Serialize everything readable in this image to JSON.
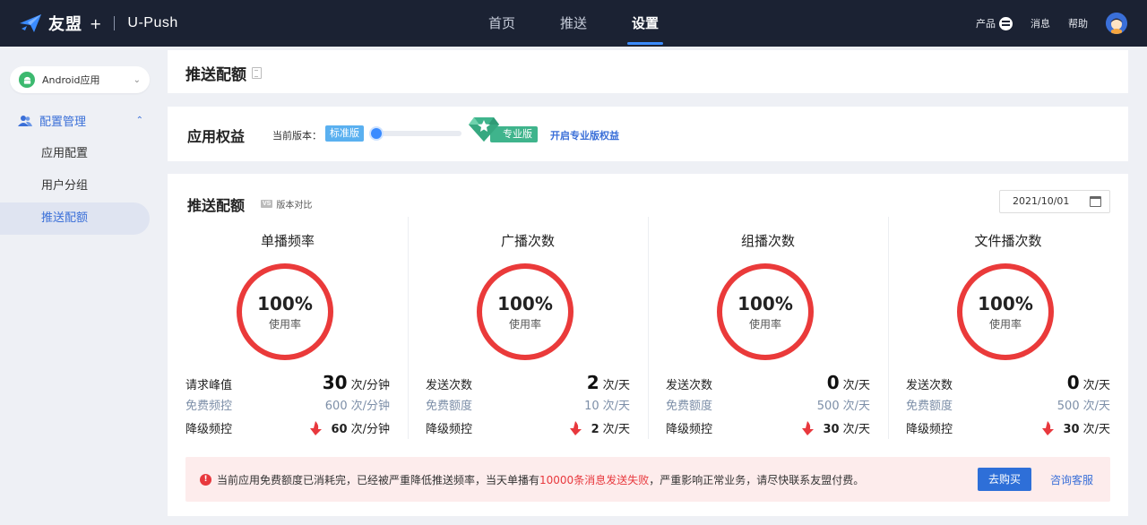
{
  "header": {
    "brand": "友盟",
    "plus": "+",
    "product": "U-Push",
    "nav": [
      {
        "label": "首页"
      },
      {
        "label": "推送"
      },
      {
        "label": "设置"
      }
    ],
    "right": {
      "products": "产品",
      "messages": "消息",
      "help": "帮助"
    }
  },
  "sidebar": {
    "app_select": "Android应用",
    "group": "配置管理",
    "items": [
      {
        "label": "应用配置"
      },
      {
        "label": "用户分组"
      },
      {
        "label": "推送配额"
      }
    ]
  },
  "page": {
    "title": "推送配额"
  },
  "rights": {
    "title": "应用权益",
    "current_version_label": "当前版本：",
    "standard": "标准版",
    "pro": "专业版",
    "pro_link": "开启专业版权益"
  },
  "quota": {
    "title": "推送配额",
    "vs_badge": "VS",
    "compare": "版本对比",
    "date": "2021/10/01",
    "columns": [
      {
        "title": "单播频率",
        "percent": "100%",
        "usage_label": "使用率",
        "r1_label": "请求峰值",
        "r1_num": "30",
        "r1_unit": "次/分钟",
        "r2_label": "免费频控",
        "r2_num": "600",
        "r2_unit": "次/分钟",
        "r3_label": "降级频控",
        "r3_num": "60",
        "r3_unit": "次/分钟"
      },
      {
        "title": "广播次数",
        "percent": "100%",
        "usage_label": "使用率",
        "r1_label": "发送次数",
        "r1_num": "2",
        "r1_unit": "次/天",
        "r2_label": "免费额度",
        "r2_num": "10",
        "r2_unit": "次/天",
        "r3_label": "降级频控",
        "r3_num": "2",
        "r3_unit": "次/天"
      },
      {
        "title": "组播次数",
        "percent": "100%",
        "usage_label": "使用率",
        "r1_label": "发送次数",
        "r1_num": "0",
        "r1_unit": "次/天",
        "r2_label": "免费额度",
        "r2_num": "500",
        "r2_unit": "次/天",
        "r3_label": "降级频控",
        "r3_num": "30",
        "r3_unit": "次/天"
      },
      {
        "title": "文件播次数",
        "percent": "100%",
        "usage_label": "使用率",
        "r1_label": "发送次数",
        "r1_num": "0",
        "r1_unit": "次/天",
        "r2_label": "免费额度",
        "r2_num": "500",
        "r2_unit": "次/天",
        "r3_label": "降级频控",
        "r3_num": "30",
        "r3_unit": "次/天"
      }
    ],
    "alert": {
      "part1": "当前应用免费额度已消耗完，已经被严重降低推送频率，当天单播有",
      "highlight": "10000条消息发送失败",
      "part2": "，严重影响正常业务，请尽快联系友盟付费。",
      "buy": "去购买",
      "consult": "咨询客服"
    }
  },
  "colors": {
    "nav_bg": "#1b2233",
    "accent": "#3a6fd8",
    "ring": "#ea3a3a",
    "pro_green": "#3fb48c",
    "alert_bg": "#fdecec"
  }
}
